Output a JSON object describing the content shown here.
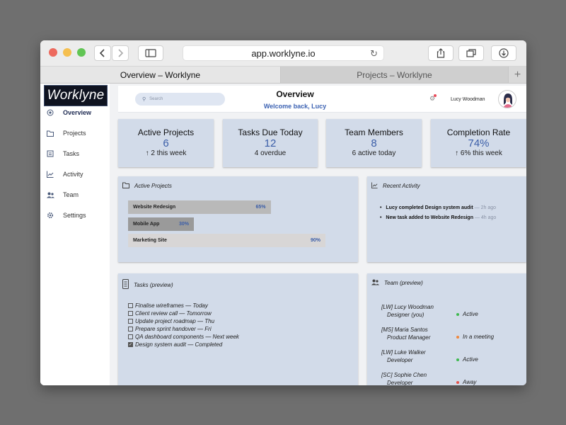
{
  "browser": {
    "url": "app.worklyne.io",
    "tabs": [
      {
        "label": "Overview – Worklyne",
        "active": true
      },
      {
        "label": "Projects – Worklyne",
        "active": false
      }
    ],
    "new_tab": "+"
  },
  "sidebar": {
    "logo": "Worklyne",
    "items": [
      {
        "label": "Overview",
        "icon": "overview-icon",
        "active": true
      },
      {
        "label": "Projects",
        "icon": "folder-icon",
        "active": false
      },
      {
        "label": "Tasks",
        "icon": "tasks-icon",
        "active": false
      },
      {
        "label": "Activity",
        "icon": "activity-icon",
        "active": false
      },
      {
        "label": "Team",
        "icon": "team-icon",
        "active": false
      },
      {
        "label": "Settings",
        "icon": "gear-icon",
        "active": false
      }
    ]
  },
  "header": {
    "search_placeholder": "Search",
    "title": "Overview",
    "subtitle": "Welcome back, Lucy",
    "user_name": "Lucy Woodman"
  },
  "stats": [
    {
      "label": "Active Projects",
      "value": "6",
      "sub": "↑ 2 this week"
    },
    {
      "label": "Tasks Due Today",
      "value": "12",
      "sub": "4 overdue"
    },
    {
      "label": "Team Members",
      "value": "8",
      "sub": "6 active today"
    },
    {
      "label": "Completion Rate",
      "value": "74%",
      "sub": "↑ 6% this week"
    }
  ],
  "projects_panel": {
    "title": "Active Projects",
    "projects": [
      {
        "name": "Website Redesign",
        "percent_label": "65%",
        "progress": 0.65,
        "color": "#b9b9b9"
      },
      {
        "name": "Mobile App",
        "percent_label": "30%",
        "progress": 0.3,
        "color": "#9a9a9a"
      },
      {
        "name": "Marketing Site",
        "percent_label": "90%",
        "progress": 0.9,
        "color": "#d8d6d6"
      }
    ]
  },
  "activity_panel": {
    "title": "Recent Activity",
    "items": [
      {
        "text": "Lucy completed Design system audit",
        "ago": "— 2h ago"
      },
      {
        "text": "New task added to Website Redesign",
        "ago": "— 4h ago"
      }
    ]
  },
  "tasks_panel": {
    "title": "Tasks (preview)",
    "tasks": [
      {
        "text": "Finalise wireframes — Today",
        "done": false
      },
      {
        "text": "Client review call — Tomorrow",
        "done": false
      },
      {
        "text": "Update project roadmap — Thu",
        "done": false
      },
      {
        "text": "Prepare sprint handover — Fri",
        "done": false
      },
      {
        "text": "QA dashboard components — Next week",
        "done": false
      },
      {
        "text": "Design system audit — Completed",
        "done": true
      }
    ]
  },
  "team_panel": {
    "title": "Team (preview)",
    "members": [
      {
        "name": "[LW]  Lucy Woodman",
        "role": "Designer (you)",
        "status": "Active",
        "status_color": "#3fb950"
      },
      {
        "name": "[MS]  Maria Santos",
        "role": "Product Manager",
        "status": "In a meeting",
        "status_color": "#f0883e"
      },
      {
        "name": "[LW]  Luke Walker",
        "role": "Developer",
        "status": "Active",
        "status_color": "#3fb950"
      },
      {
        "name": "[SC]  Sophie Chen",
        "role": "Developer",
        "status": "Away",
        "status_color": "#e5534b"
      }
    ]
  }
}
